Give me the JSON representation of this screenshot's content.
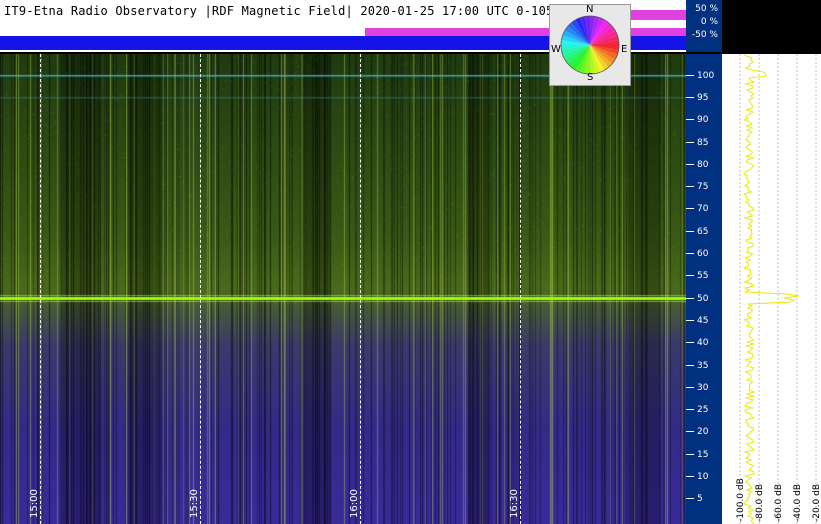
{
  "title": "IT9-Etna Radio Observatory |RDF Magnetic Field| 2020-01-25 17:00 UTC 0-105 Hz",
  "percent_axis": [
    "50 %",
    "0 %",
    "-50 %"
  ],
  "compass": {
    "north": "N",
    "south": "S",
    "east": "E",
    "west": "W"
  },
  "frequency_axis": [
    "100",
    "95",
    "90",
    "85",
    "80",
    "75",
    "70",
    "65",
    "60",
    "55",
    "50",
    "45",
    "40",
    "35",
    "30",
    "25",
    "20",
    "15",
    "10",
    "5"
  ],
  "time_axis": [
    "15:00",
    "15:30",
    "16:00",
    "16:30"
  ],
  "db_axis": [
    "-100.0 dB",
    "-80.0 dB",
    "-60.0 dB",
    "-40.0 dB",
    "-20.0 dB"
  ],
  "colors": {
    "accent_line": "#9aff00",
    "axis_bg": "#003080",
    "profile_trace": "#e8e800"
  }
}
